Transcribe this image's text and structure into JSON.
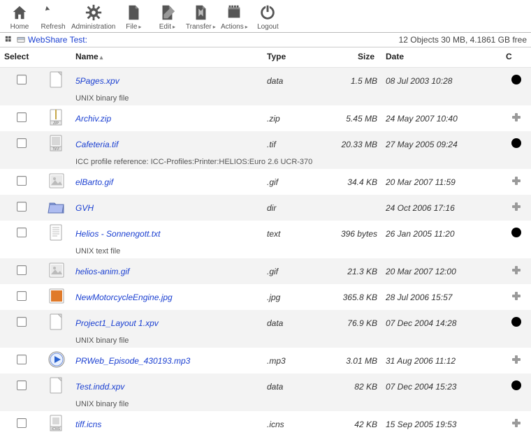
{
  "toolbar": [
    {
      "id": "home",
      "label": "Home"
    },
    {
      "id": "refresh",
      "label": "Refresh"
    },
    {
      "id": "admin",
      "label": "Administration"
    },
    {
      "id": "file",
      "label": "File",
      "menu": true
    },
    {
      "id": "edit",
      "label": "Edit",
      "menu": true
    },
    {
      "id": "transfer",
      "label": "Transfer",
      "menu": true
    },
    {
      "id": "actions",
      "label": "Actions",
      "menu": true
    },
    {
      "id": "logout",
      "label": "Logout"
    }
  ],
  "path": {
    "label": "WebShare Test:"
  },
  "status": "12 Objects 30 MB, 4.1861 GB free",
  "columns": {
    "select": "Select",
    "name": "Name",
    "type": "Type",
    "size": "Size",
    "date": "Date",
    "action": "C"
  },
  "sort": {
    "column": "name",
    "dir": "asc"
  },
  "files": [
    {
      "name": "5Pages.xpv",
      "type": "data",
      "size": "1.5 MB",
      "date": "08 Jul 2003 10:28",
      "icon": "page",
      "action": "info",
      "sub": "UNIX binary file"
    },
    {
      "name": "Archiv.zip",
      "type": ".zip",
      "size": "5.45 MB",
      "date": "24 May 2007 10:40",
      "icon": "zip",
      "action": "plus"
    },
    {
      "name": "Cafeteria.tif",
      "type": ".tif",
      "size": "20.33 MB",
      "date": "27 May 2005 09:24",
      "icon": "tiff",
      "action": "info",
      "sub": "ICC profile reference: ICC-Profiles:Printer:HELIOS:Euro 2.6 UCR-370"
    },
    {
      "name": "elBarto.gif",
      "type": ".gif",
      "size": "34.4 KB",
      "date": "20 Mar 2007 11:59",
      "icon": "thumb",
      "action": "plus"
    },
    {
      "name": "GVH",
      "type": "dir",
      "size": "",
      "date": "24 Oct 2006 17:16",
      "icon": "folder",
      "action": "plus"
    },
    {
      "name": "Helios - Sonnengott.txt",
      "type": "text",
      "size": "396 bytes",
      "date": "26 Jan 2005 11:20",
      "icon": "text",
      "action": "info",
      "sub": "UNIX text file"
    },
    {
      "name": "helios-anim.gif",
      "type": ".gif",
      "size": "21.3 KB",
      "date": "20 Mar 2007 12:00",
      "icon": "thumb",
      "action": "plus"
    },
    {
      "name": "NewMotorcycleEngine.jpg",
      "type": ".jpg",
      "size": "365.8 KB",
      "date": "28 Jul 2006 15:57",
      "icon": "thumb-color",
      "action": "plus"
    },
    {
      "name": "Project1_Layout 1.xpv",
      "type": "data",
      "size": "76.9 KB",
      "date": "07 Dec 2004 14:28",
      "icon": "page",
      "action": "info",
      "sub": "UNIX binary file"
    },
    {
      "name": "PRWeb_Episode_430193.mp3",
      "type": ".mp3",
      "size": "3.01 MB",
      "date": "31 Aug 2006 11:12",
      "icon": "media",
      "action": "plus"
    },
    {
      "name": "Test.indd.xpv",
      "type": "data",
      "size": "82 KB",
      "date": "07 Dec 2004 15:23",
      "icon": "page",
      "action": "info",
      "sub": "UNIX binary file"
    },
    {
      "name": "tiff.icns",
      "type": ".icns",
      "size": "42 KB",
      "date": "15 Sep 2005 19:53",
      "icon": "icns",
      "action": "plus"
    }
  ]
}
